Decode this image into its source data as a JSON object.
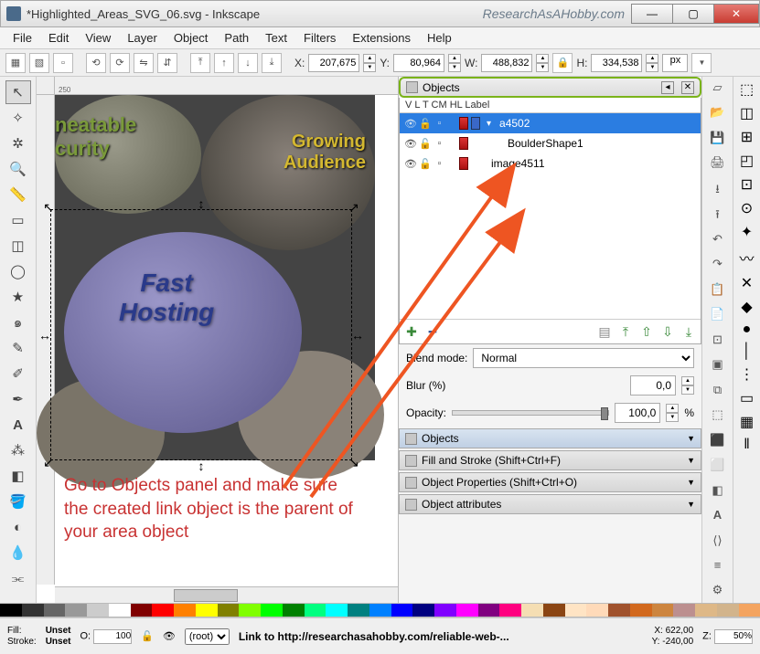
{
  "window": {
    "title": "*Highlighted_Areas_SVG_06.svg - Inkscape",
    "watermark": "ResearchAsAHobby.com"
  },
  "menu": [
    "File",
    "Edit",
    "View",
    "Layer",
    "Object",
    "Path",
    "Text",
    "Filters",
    "Extensions",
    "Help"
  ],
  "toolbar": {
    "x_label": "X:",
    "x": "207,675",
    "y_label": "Y:",
    "y": "80,964",
    "w_label": "W:",
    "w": "488,832",
    "h_label": "H:",
    "h": "334,538",
    "unit": "px"
  },
  "tools": [
    "pointer",
    "node",
    "tweak",
    "zoom",
    "measure",
    "rect",
    "3dbox",
    "ellipse",
    "star",
    "spiral",
    "pencil",
    "bezier",
    "calligraphy",
    "text",
    "spray",
    "eraser",
    "fill",
    "gradient",
    "dropper",
    "connector"
  ],
  "canvas": {
    "ruler_text": "250",
    "text_security": "neatable\ncurity",
    "text_audience": "Growing\nAudience",
    "text_fast": "Fast\nHosting",
    "note": "Go to Objects panel and make sure the created link object is the parent of your area object"
  },
  "objects_panel": {
    "title": "Objects",
    "cols": "V  L  T   CM HL Label",
    "rows": [
      {
        "label": "a4502",
        "selected": true,
        "indent": 0
      },
      {
        "label": "BoulderShape1",
        "selected": false,
        "indent": 1
      },
      {
        "label": "image4511",
        "selected": false,
        "indent": 0
      }
    ],
    "blend_label": "Blend mode:",
    "blend_value": "Normal",
    "blur_label": "Blur (%)",
    "blur_value": "0,0",
    "opacity_label": "Opacity:",
    "opacity_value": "100,0",
    "opacity_unit": "%"
  },
  "docks": [
    {
      "label": "Objects"
    },
    {
      "label": "Fill and Stroke (Shift+Ctrl+F)"
    },
    {
      "label": "Object Properties (Shift+Ctrl+O)"
    },
    {
      "label": "Object attributes"
    }
  ],
  "status": {
    "fill_label": "Fill:",
    "fill_value": "Unset",
    "stroke_label": "Stroke:",
    "stroke_value": "Unset",
    "o_label": "O:",
    "o_value": "100",
    "layer": "(root)",
    "hint": "Link to http://researchasahobby.com/reliable-web-...",
    "coords_x": "X:   622,00",
    "coords_y": "Y:  -240,00",
    "z_label": "Z:",
    "z_value": "50%"
  },
  "palette": [
    "#000",
    "#333",
    "#666",
    "#999",
    "#ccc",
    "#fff",
    "#800000",
    "#f00",
    "#ff8000",
    "#ff0",
    "#808000",
    "#80ff00",
    "#0f0",
    "#008000",
    "#00ff80",
    "#0ff",
    "#008080",
    "#0080ff",
    "#00f",
    "#000080",
    "#8000ff",
    "#f0f",
    "#800080",
    "#ff0080",
    "#f5deb3",
    "#8b4513",
    "#ffe4c4",
    "#ffdab9",
    "#a0522d",
    "#d2691e",
    "#cd853f",
    "#bc8f8f",
    "#deb887",
    "#d2b48c",
    "#f4a460"
  ]
}
